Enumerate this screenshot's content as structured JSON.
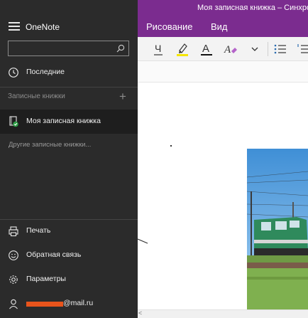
{
  "window": {
    "title": "Моя записная книжка – Синхронизац"
  },
  "ribbon": {
    "tabs": [
      "Рисование",
      "Вид"
    ]
  },
  "toolbar": {
    "underline_glyph": "Ч",
    "font_color_glyph": "A"
  },
  "nav": {
    "app_name": "OneNote",
    "search": {
      "value": "",
      "placeholder": ""
    },
    "recent_label": "Последние",
    "notebooks_header": "Записные книжки",
    "add_notebook_glyph": "+",
    "current_notebook": "Моя записная книжка",
    "other_notebooks": "Другие записные книжки...",
    "print_label": "Печать",
    "feedback_label": "Обратная связь",
    "settings_label": "Параметры",
    "account_email_suffix": "@mail.ru"
  },
  "colors": {
    "accent": "#7b2c8f",
    "nav_bg": "#2b2b2b",
    "selected_bg": "#1e1e1e",
    "redaction": "#e8541c",
    "sync_badge": "#2e9e46"
  }
}
